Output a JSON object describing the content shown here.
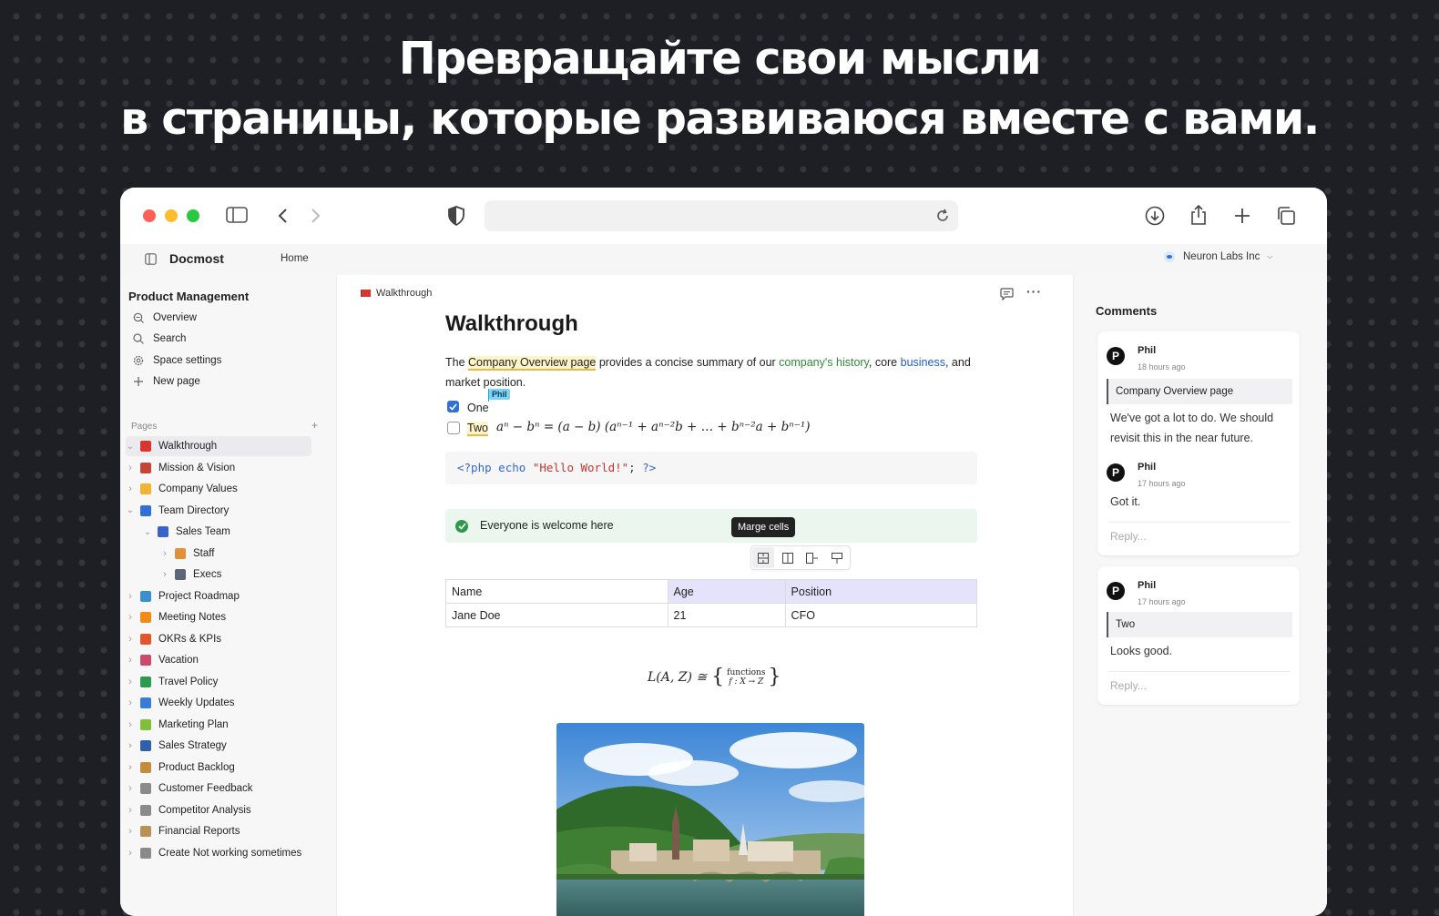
{
  "hero": {
    "line1": "Превращайте свои мысли",
    "line2": "в страницы, которые развиваюся вместе с вами."
  },
  "app": {
    "name": "Docmost",
    "home": "Home",
    "workspace": "Neuron Labs Inc"
  },
  "sidebar": {
    "space_title": "Product Management",
    "actions": [
      {
        "label": "Overview",
        "icon": "overview-icon"
      },
      {
        "label": "Search",
        "icon": "search-icon"
      },
      {
        "label": "Space settings",
        "icon": "gear-icon"
      },
      {
        "label": "New page",
        "icon": "plus-icon"
      }
    ],
    "pages_label": "Pages",
    "pages": [
      {
        "label": "Walkthrough",
        "icon": "flag-icon",
        "color": "#d9352f",
        "depth": 0,
        "active": true,
        "open": true
      },
      {
        "label": "Mission & Vision",
        "icon": "flag-us-icon",
        "color": "#c2453a",
        "depth": 0
      },
      {
        "label": "Company Values",
        "icon": "trophy-icon",
        "color": "#f2b233",
        "depth": 0
      },
      {
        "label": "Team Directory",
        "icon": "directory-icon",
        "color": "#2f6fd6",
        "depth": 0,
        "open": true
      },
      {
        "label": "Sales Team",
        "icon": "people-icon",
        "color": "#3a63c9",
        "depth": 1,
        "open": true
      },
      {
        "label": "Staff",
        "icon": "person-icon",
        "color": "#e0913a",
        "depth": 2
      },
      {
        "label": "Execs",
        "icon": "building-icon",
        "color": "#5b6676",
        "depth": 2
      },
      {
        "label": "Project Roadmap",
        "icon": "map-icon",
        "color": "#3b8fd1",
        "depth": 0
      },
      {
        "label": "Meeting Notes",
        "icon": "circle-icon",
        "color": "#f28a1a",
        "depth": 0
      },
      {
        "label": "OKRs & KPIs",
        "icon": "target-icon",
        "color": "#e2562e",
        "depth": 0
      },
      {
        "label": "Vacation",
        "icon": "plane-icon",
        "color": "#c94a6d",
        "depth": 0
      },
      {
        "label": "Travel Policy",
        "icon": "flag-it-icon",
        "color": "#2e9a4f",
        "depth": 0
      },
      {
        "label": "Weekly Updates",
        "icon": "calendar-icon",
        "color": "#3a7bd5",
        "depth": 0
      },
      {
        "label": "Marketing Plan",
        "icon": "ball-icon",
        "color": "#7fbf3a",
        "depth": 0
      },
      {
        "label": "Sales Strategy",
        "icon": "strategy-icon",
        "color": "#2f5fa8",
        "depth": 0
      },
      {
        "label": "Product Backlog",
        "icon": "box-icon",
        "color": "#c58b3a",
        "depth": 0
      },
      {
        "label": "Customer Feedback",
        "icon": "feedback-icon",
        "color": "#8a8a8a",
        "depth": 0
      },
      {
        "label": "Competitor Analysis",
        "icon": "pencil-icon",
        "color": "#8a8a8a",
        "depth": 0
      },
      {
        "label": "Financial Reports",
        "icon": "report-icon",
        "color": "#b89358",
        "depth": 0
      },
      {
        "label": "Create Not working sometimes",
        "icon": "star-icon",
        "color": "#8a8a8a",
        "depth": 0
      }
    ]
  },
  "doc": {
    "breadcrumb": "Walkthrough",
    "title": "Walkthrough",
    "para": {
      "t1": "The ",
      "link1": "Company Overview page",
      "t2": " provides a concise summary of our ",
      "link2": "company's history",
      "t3": ", core ",
      "link3": "business",
      "t4": ", and",
      "line2": "market position."
    },
    "checklist": [
      {
        "label": "One",
        "checked": true,
        "cursor": "Phil"
      },
      {
        "label": "Two",
        "checked": false
      }
    ],
    "math1": "aⁿ − bⁿ = (a − b) (aⁿ⁻¹ + aⁿ⁻²b + … + bⁿ⁻²a + bⁿ⁻¹)",
    "code": {
      "open": "<?php",
      "kw": "echo",
      "str": "\"Hello World!\"",
      "semi": ";",
      "close": "?>"
    },
    "callout": "Everyone is welcome here",
    "tooltip": "Marge cells",
    "table": {
      "headers": [
        "Name",
        "Age",
        "Position"
      ],
      "rows": [
        [
          "Jane Doe",
          "21",
          "CFO"
        ]
      ]
    },
    "math2": {
      "lhs": "L(A, Z) ≅",
      "top": "functions",
      "bottom": "f : X → Z"
    }
  },
  "comments": {
    "title": "Comments",
    "threads": [
      {
        "quote": "Company Overview page",
        "items": [
          {
            "author": "Phil",
            "time": "18 hours ago",
            "text": "We've got a lot to do. We should revisit this in the near future."
          },
          {
            "author": "Phil",
            "time": "17 hours ago",
            "text": "Got it."
          }
        ],
        "reply": "Reply..."
      },
      {
        "quote": "Two",
        "items": [
          {
            "author": "Phil",
            "time": "17 hours ago",
            "text": "Looks good."
          }
        ],
        "reply": "Reply..."
      }
    ]
  },
  "colors": {
    "accent": "#2f6fd6",
    "green_link": "#2e8b3a",
    "blue_link": "#1f5bd8",
    "active_row": "#ebebef",
    "highlight": "#e5e3fb",
    "callout_bg": "#ebf7ee"
  }
}
